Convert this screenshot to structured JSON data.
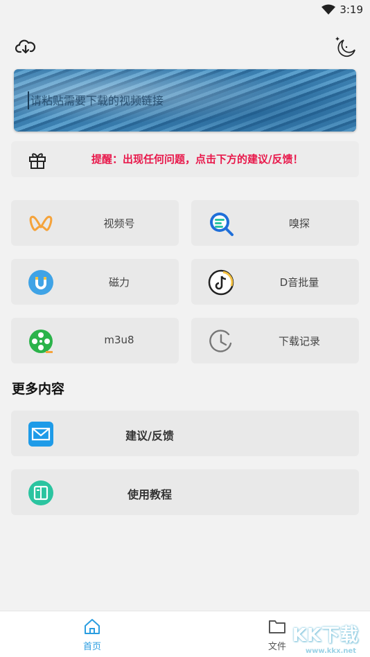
{
  "status_bar": {
    "time": "3:19"
  },
  "search": {
    "placeholder": "请粘贴需要下载的视频链接"
  },
  "notice": {
    "text": "提醒：出现任何问题，点击下方的建议/反馈！"
  },
  "grid": [
    {
      "label": "视频号",
      "icon": "butterfly-icon"
    },
    {
      "label": "嗅探",
      "icon": "sniff-search-icon"
    },
    {
      "label": "磁力",
      "icon": "magnet-icon"
    },
    {
      "label": "D音批量",
      "icon": "tiktok-music-icon"
    },
    {
      "label": "m3u8",
      "icon": "film-reel-icon"
    },
    {
      "label": "下载记录",
      "icon": "history-clock-icon"
    }
  ],
  "more": {
    "title": "更多内容",
    "items": [
      {
        "label": "建议/反馈",
        "icon": "mail-icon"
      },
      {
        "label": "使用教程",
        "icon": "book-icon"
      }
    ]
  },
  "nav": {
    "home": "首页",
    "file": "文件"
  },
  "watermark": {
    "brand": "KK下载",
    "url": "www.kkx.net"
  },
  "colors": {
    "accent": "#2a9de0",
    "notice": "#e8174a"
  }
}
